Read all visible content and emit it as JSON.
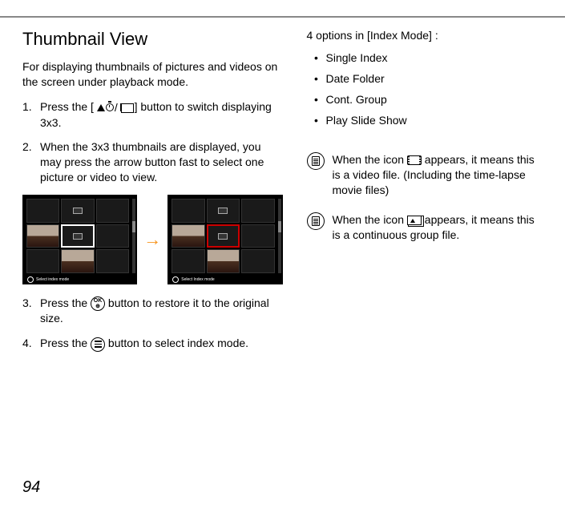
{
  "title": "Thumbnail View",
  "intro": "For displaying thumbnails of pictures and videos on the screen under playback mode.",
  "steps": {
    "s1_pre": "Press the [ ",
    "s1_post": " ] button to switch displaying 3x3.",
    "s2": "When the 3x3 thumbnails are displayed, you may press the arrow button fast to select one picture or video to view.",
    "s3_pre": "Press the ",
    "s3_post": " button to restore it to the original size.",
    "s4_pre": "Press the ",
    "s4_post": " button to select index mode."
  },
  "thumb_caption_left": "Select index mode",
  "thumb_caption_right": "Select Index mode",
  "right": {
    "heading": "4 options in [Index Mode] :",
    "options": [
      "Single Index",
      "Date Folder",
      "Cont. Group",
      "Play Slide Show"
    ],
    "note1_pre": "When the icon ",
    "note1_post": " appears, it means this is a video file. (Including the time-lapse movie files)",
    "note2_pre": "When the icon ",
    "note2_post": " appears, it means this is a continuous group file."
  },
  "ok_label_top": "OK",
  "ok_label_bot": "⊕",
  "page_number": "94"
}
